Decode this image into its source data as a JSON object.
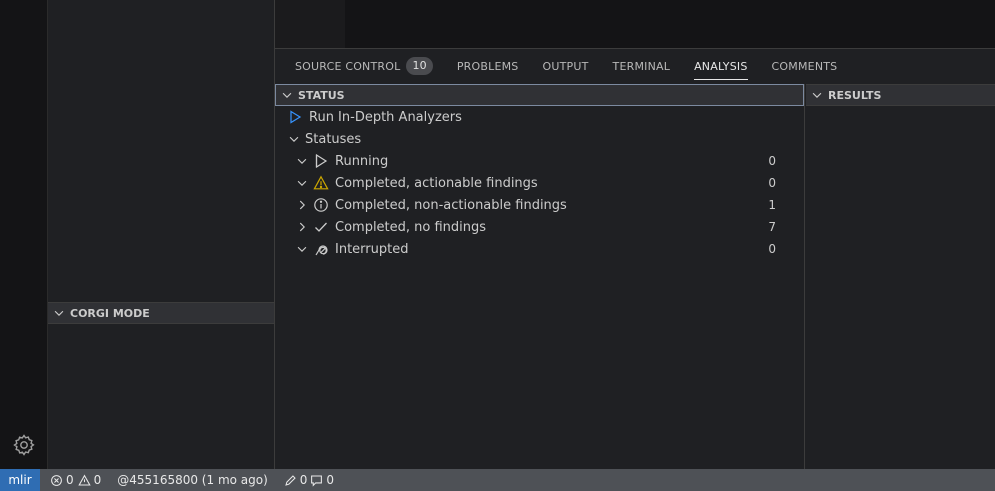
{
  "sidebar": {
    "section_title": "CORGI MODE"
  },
  "panel": {
    "tabs": [
      {
        "label": "SOURCE CONTROL",
        "badge": "10",
        "active": false
      },
      {
        "label": "PROBLEMS",
        "active": false
      },
      {
        "label": "OUTPUT",
        "active": false
      },
      {
        "label": "TERMINAL",
        "active": false
      },
      {
        "label": "ANALYSIS",
        "active": true
      },
      {
        "label": "COMMENTS",
        "active": false
      }
    ],
    "status_header": "STATUS",
    "results_header": "RESULTS",
    "run_action": "Run In-Depth Analyzers",
    "statuses_group": "Statuses",
    "statuses": [
      {
        "label": "Running",
        "count": "0",
        "icon": "play-outline-icon",
        "expanded": true
      },
      {
        "label": "Completed, actionable findings",
        "count": "0",
        "icon": "warning-icon",
        "expanded": true
      },
      {
        "label": "Completed, non-actionable findings",
        "count": "1",
        "icon": "info-icon",
        "expanded": false
      },
      {
        "label": "Completed, no findings",
        "count": "7",
        "icon": "check-icon",
        "expanded": false
      },
      {
        "label": "Interrupted",
        "count": "0",
        "icon": "interrupted-icon",
        "expanded": true
      }
    ]
  },
  "statusbar": {
    "remote": "mlir",
    "errors": "0",
    "warnings": "0",
    "blame": "@455165800 (1 mo ago)",
    "edits": "0",
    "comments": "0"
  },
  "colors": {
    "accent": "#2f6db3",
    "warning": "#cca700",
    "run_link": "#8ab4f8"
  }
}
